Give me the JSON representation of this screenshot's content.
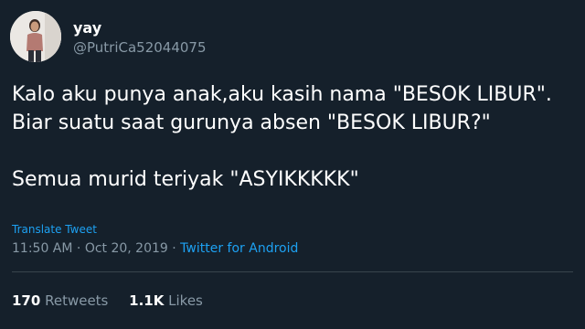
{
  "user": {
    "display_name": "yay",
    "handle": "@PutriCa52044075"
  },
  "tweet": {
    "lines": [
      "Kalo aku punya anak,aku kasih nama \"BESOK LIBUR\".",
      "Biar suatu saat gurunya absen \"BESOK LIBUR?\"",
      "Semua murid teriyak \"ASYIKKKKK\""
    ],
    "translate_label": "Translate Tweet",
    "time": "11:50 AM",
    "separator": "·",
    "date": "Oct 20, 2019",
    "source": "Twitter for Android"
  },
  "stats": {
    "retweets_count": "170",
    "retweets_label": "Retweets",
    "likes_count": "1.1K",
    "likes_label": "Likes"
  },
  "colors": {
    "background": "#15202b",
    "text": "#ffffff",
    "secondary": "#8899a6",
    "accent": "#1da1f2",
    "divider": "#38444d"
  }
}
